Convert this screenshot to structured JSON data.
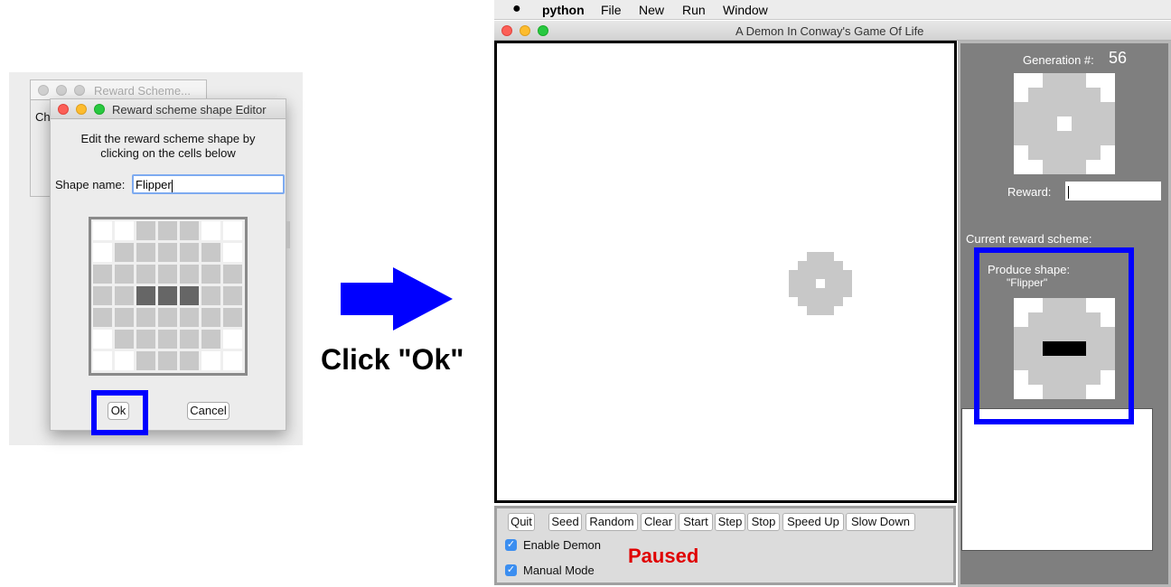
{
  "left": {
    "back_window": {
      "title": "Reward Scheme...",
      "partial_text": "Ch"
    },
    "editor": {
      "title": "Reward scheme shape Editor",
      "instruction_line1": "Edit the reward scheme shape by",
      "instruction_line2": "clicking on the cells below",
      "shape_name_label": "Shape name:",
      "shape_name_value": "Flipper",
      "grid_rows": [
        "0022200",
        "0222220",
        "2222222",
        "2233322",
        "2222222",
        "0222220",
        "0022200"
      ],
      "grid_legend": {
        "0": "white",
        "2": "light gray",
        "3": "dark gray"
      },
      "ok_label": "Ok",
      "cancel_label": "Cancel"
    }
  },
  "arrow_caption": "Click \"Ok\"",
  "app": {
    "menu": {
      "app_name": "python",
      "items": [
        "File",
        "New",
        "Run",
        "Window"
      ]
    },
    "window_title": "A Demon In Conway's Game Of Life",
    "controls": {
      "buttons": [
        "Quit",
        "Seed",
        "Random",
        "Clear",
        "Start",
        "Step",
        "Stop",
        "Speed Up",
        "Slow Down"
      ],
      "enable_demon_label": "Enable Demon",
      "manual_mode_label": "Manual Mode",
      "enable_demon_checked": true,
      "manual_mode_checked": true,
      "status": "Paused"
    },
    "side": {
      "generation_label": "Generation #:",
      "generation_value": "56",
      "reward_label": "Reward:",
      "reward_value": "",
      "current_scheme_label": "Current reward scheme:",
      "produce_shape_label": "Produce shape:",
      "produce_shape_name": "\"Flipper\""
    }
  },
  "colors": {
    "highlight": "#0000ff",
    "status": "#e00000",
    "cell_gray": "#c8c8c8",
    "cell_black": "#000000",
    "arrow": "#0000ff"
  }
}
